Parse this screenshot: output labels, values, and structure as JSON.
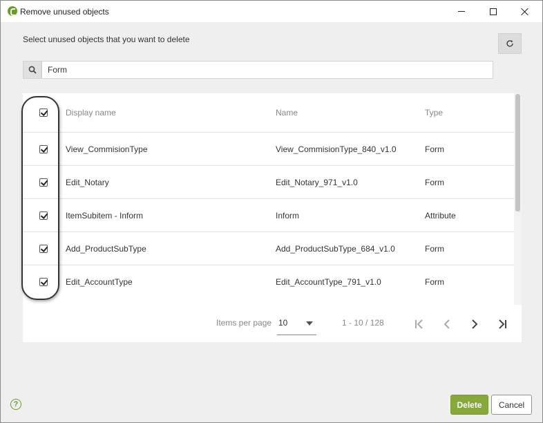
{
  "window": {
    "title": "Remove unused objects",
    "minimize_icon": "minimize-icon",
    "maximize_icon": "maximize-icon",
    "close_icon": "close-icon"
  },
  "instruction": "Select unused objects that you want to delete",
  "refresh_icon": "refresh-icon",
  "search": {
    "icon": "search-icon",
    "value": "Form",
    "placeholder": ""
  },
  "table": {
    "select_all_checked": true,
    "columns": {
      "display_name": "Display name",
      "name": "Name",
      "type": "Type"
    },
    "rows": [
      {
        "checked": true,
        "display_name": "View_CommisionType",
        "name": "View_CommisionType_840_v1.0",
        "type": "Form"
      },
      {
        "checked": true,
        "display_name": "Edit_Notary",
        "name": "Edit_Notary_971_v1.0",
        "type": "Form"
      },
      {
        "checked": true,
        "display_name": "ItemSubitem - Inform",
        "name": "Inform",
        "type": "Attribute"
      },
      {
        "checked": true,
        "display_name": "Add_ProductSubType",
        "name": "Add_ProductSubType_684_v1.0",
        "type": "Form"
      },
      {
        "checked": true,
        "display_name": "Edit_AccountType",
        "name": "Edit_AccountType_791_v1.0",
        "type": "Form"
      }
    ]
  },
  "pager": {
    "items_per_page_label": "Items per page",
    "items_per_page_value": "10",
    "range_text": "1 - 10 / 128",
    "first_icon": "first-page-icon",
    "prev_icon": "prev-page-icon",
    "next_icon": "next-page-icon",
    "last_icon": "last-page-icon"
  },
  "footer": {
    "help_label": "?",
    "delete_label": "Delete",
    "cancel_label": "Cancel"
  },
  "colors": {
    "accent": "#86a93a",
    "accent_border": "#7a9c30",
    "background": "#efefef"
  }
}
